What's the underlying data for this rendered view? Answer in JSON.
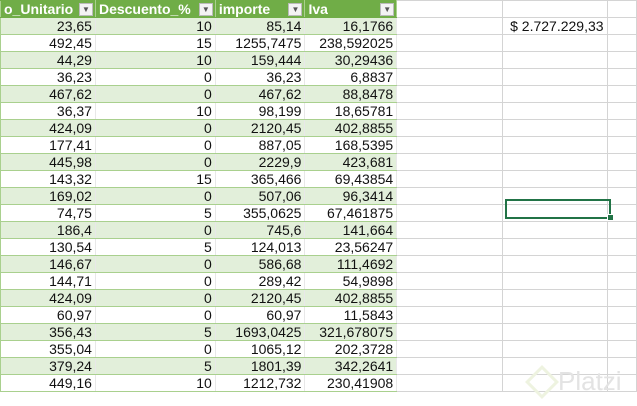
{
  "headers": [
    "o_Unitario",
    "Descuento_%",
    "importe",
    "Iva"
  ],
  "rows": [
    [
      "23,65",
      "10",
      "85,14",
      "16,1766"
    ],
    [
      "492,45",
      "15",
      "1255,7475",
      "238,592025"
    ],
    [
      "44,29",
      "10",
      "159,444",
      "30,29436"
    ],
    [
      "36,23",
      "0",
      "36,23",
      "6,8837"
    ],
    [
      "467,62",
      "0",
      "467,62",
      "88,8478"
    ],
    [
      "36,37",
      "10",
      "98,199",
      "18,65781"
    ],
    [
      "424,09",
      "0",
      "2120,45",
      "402,8855"
    ],
    [
      "177,41",
      "0",
      "887,05",
      "168,5395"
    ],
    [
      "445,98",
      "0",
      "2229,9",
      "423,681"
    ],
    [
      "143,32",
      "15",
      "365,466",
      "69,43854"
    ],
    [
      "169,02",
      "0",
      "507,06",
      "96,3414"
    ],
    [
      "74,75",
      "5",
      "355,0625",
      "67,461875"
    ],
    [
      "186,4",
      "0",
      "745,6",
      "141,664"
    ],
    [
      "130,54",
      "5",
      "124,013",
      "23,56247"
    ],
    [
      "146,67",
      "0",
      "586,68",
      "111,4692"
    ],
    [
      "144,71",
      "0",
      "289,42",
      "54,9898"
    ],
    [
      "424,09",
      "0",
      "2120,45",
      "402,8855"
    ],
    [
      "60,97",
      "0",
      "60,97",
      "11,5843"
    ],
    [
      "356,43",
      "5",
      "1693,0425",
      "321,678075"
    ],
    [
      "355,04",
      "0",
      "1065,12",
      "202,3728"
    ],
    [
      "379,24",
      "5",
      "1801,39",
      "342,2641"
    ],
    [
      "449,16",
      "10",
      "1212,732",
      "230,41908"
    ]
  ],
  "total": "$ 2.727.229,33",
  "watermark": "Platzi",
  "colors": {
    "header": "#70AD47",
    "band": "#E2EFDA",
    "selection": "#217346"
  }
}
